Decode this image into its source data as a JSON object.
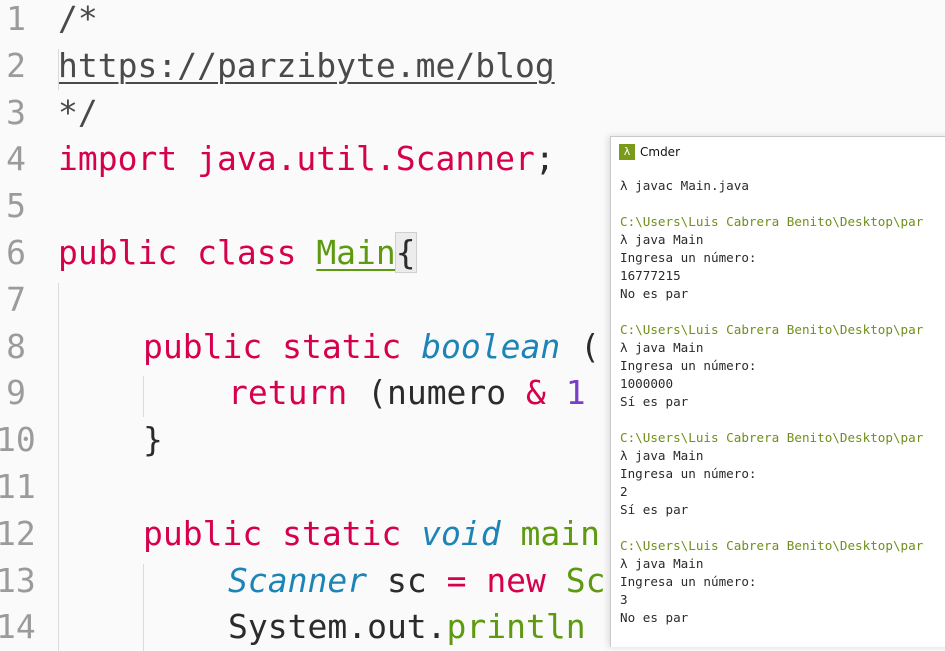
{
  "editor": {
    "lines": [
      {
        "n": "1",
        "indent": 0,
        "tokens": [
          {
            "t": "cm",
            "v": "/*"
          }
        ]
      },
      {
        "n": "2",
        "indent": 0,
        "tokens": [
          {
            "t": "link",
            "v": "https://parzibyte.me/blog"
          }
        ]
      },
      {
        "n": "3",
        "indent": 0,
        "tokens": [
          {
            "t": "cm",
            "v": "*/"
          }
        ]
      },
      {
        "n": "4",
        "indent": 0,
        "tokens": [
          {
            "t": "kw",
            "v": "import"
          },
          {
            "t": "plain",
            "v": " "
          },
          {
            "t": "kw",
            "v": "java.util.Scanner"
          },
          {
            "t": "plain",
            "v": ";"
          }
        ]
      },
      {
        "n": "5",
        "indent": 0,
        "tokens": []
      },
      {
        "n": "6",
        "indent": 0,
        "tokens": [
          {
            "t": "kw",
            "v": "public"
          },
          {
            "t": "plain",
            "v": " "
          },
          {
            "t": "kw",
            "v": "class"
          },
          {
            "t": "plain",
            "v": " "
          },
          {
            "t": "cls",
            "v": "Main"
          },
          {
            "t": "brace",
            "v": "{"
          }
        ]
      },
      {
        "n": "7",
        "indent": 0,
        "tokens": []
      },
      {
        "n": "8",
        "indent": 1,
        "tokens": [
          {
            "t": "kw",
            "v": "public"
          },
          {
            "t": "plain",
            "v": " "
          },
          {
            "t": "kw",
            "v": "static"
          },
          {
            "t": "plain",
            "v": " "
          },
          {
            "t": "type",
            "v": "boolean"
          },
          {
            "t": "plain",
            "v": " ("
          }
        ]
      },
      {
        "n": "9",
        "indent": 2,
        "tokens": [
          {
            "t": "kw",
            "v": "return"
          },
          {
            "t": "plain",
            "v": " (numero "
          },
          {
            "t": "op",
            "v": "&"
          },
          {
            "t": "plain",
            "v": " "
          },
          {
            "t": "num",
            "v": "1"
          }
        ]
      },
      {
        "n": "10",
        "indent": 1,
        "tokens": [
          {
            "t": "plain",
            "v": "}"
          }
        ]
      },
      {
        "n": "11",
        "indent": 0,
        "tokens": []
      },
      {
        "n": "12",
        "indent": 1,
        "tokens": [
          {
            "t": "kw",
            "v": "public"
          },
          {
            "t": "plain",
            "v": " "
          },
          {
            "t": "kw",
            "v": "static"
          },
          {
            "t": "plain",
            "v": " "
          },
          {
            "t": "type",
            "v": "void"
          },
          {
            "t": "plain",
            "v": " "
          },
          {
            "t": "fn",
            "v": "main"
          }
        ]
      },
      {
        "n": "13",
        "indent": 2,
        "tokens": [
          {
            "t": "type",
            "v": "Scanner"
          },
          {
            "t": "plain",
            "v": " sc "
          },
          {
            "t": "op",
            "v": "="
          },
          {
            "t": "plain",
            "v": " "
          },
          {
            "t": "kw",
            "v": "new"
          },
          {
            "t": "plain",
            "v": " "
          },
          {
            "t": "fn",
            "v": "Sc"
          }
        ]
      },
      {
        "n": "14",
        "indent": 2,
        "tokens": [
          {
            "t": "plain",
            "v": "System.out."
          },
          {
            "t": "fn",
            "v": "println"
          }
        ]
      }
    ]
  },
  "terminal": {
    "title": "Cmder",
    "icon": "lambda-icon",
    "icon_glyph": "λ",
    "lines": [
      {
        "kind": "cmd",
        "text": "λ javac Main.java"
      },
      {
        "kind": "blank",
        "text": ""
      },
      {
        "kind": "path",
        "text": "C:\\Users\\Luis Cabrera Benito\\Desktop\\par"
      },
      {
        "kind": "cmd",
        "text": "λ java Main"
      },
      {
        "kind": "out",
        "text": "Ingresa un número:"
      },
      {
        "kind": "out",
        "text": "16777215"
      },
      {
        "kind": "out",
        "text": "No es par"
      },
      {
        "kind": "blank",
        "text": ""
      },
      {
        "kind": "path",
        "text": "C:\\Users\\Luis Cabrera Benito\\Desktop\\par"
      },
      {
        "kind": "cmd",
        "text": "λ java Main"
      },
      {
        "kind": "out",
        "text": "Ingresa un número:"
      },
      {
        "kind": "out",
        "text": "1000000"
      },
      {
        "kind": "out",
        "text": "Sí es par"
      },
      {
        "kind": "blank",
        "text": ""
      },
      {
        "kind": "path",
        "text": "C:\\Users\\Luis Cabrera Benito\\Desktop\\par"
      },
      {
        "kind": "cmd",
        "text": "λ java Main"
      },
      {
        "kind": "out",
        "text": "Ingresa un número:"
      },
      {
        "kind": "out",
        "text": "2"
      },
      {
        "kind": "out",
        "text": "Sí es par"
      },
      {
        "kind": "blank",
        "text": ""
      },
      {
        "kind": "path",
        "text": "C:\\Users\\Luis Cabrera Benito\\Desktop\\par"
      },
      {
        "kind": "cmd",
        "text": "λ java Main"
      },
      {
        "kind": "out",
        "text": "Ingresa un número:"
      },
      {
        "kind": "out",
        "text": "3"
      },
      {
        "kind": "out",
        "text": "No es par"
      }
    ]
  }
}
